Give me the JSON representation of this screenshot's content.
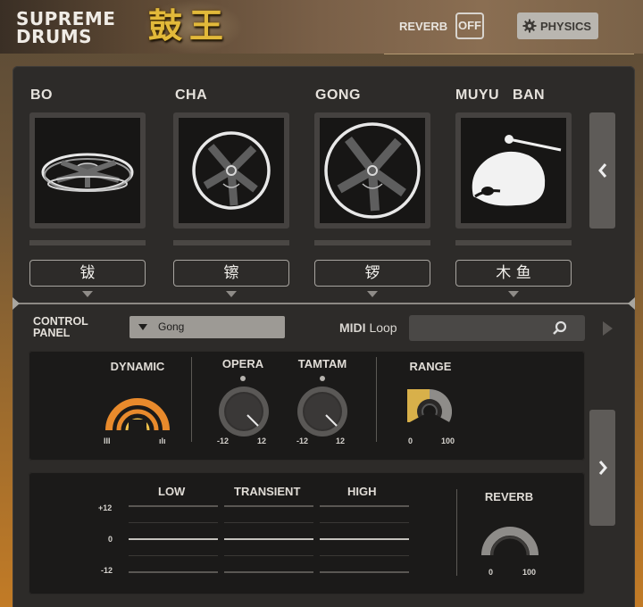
{
  "header": {
    "logo_line1": "SUPREME",
    "logo_line2": "DRUMS",
    "logo_cn": "鼓王",
    "reverb_label": "REVERB",
    "reverb_toggle": "OFF",
    "physics_label": "PHYSICS"
  },
  "instruments": [
    {
      "name": "BO",
      "cn": "钹",
      "icon": "cymbal-icon"
    },
    {
      "name": "CHA",
      "cn": "镲",
      "icon": "small-cymbal-icon"
    },
    {
      "name": "GONG",
      "cn": "锣",
      "icon": "gong-icon"
    },
    {
      "name": "MUYU   BAN",
      "cn": "木 鱼",
      "icon": "wooden-fish-icon"
    }
  ],
  "control_panel": {
    "label_line1": "CONTROL",
    "label_line2": "PANEL",
    "selected_instrument": "Gong",
    "midi_label": "MIDI",
    "loop_label": "Loop"
  },
  "knobs": {
    "dynamic": {
      "title": "DYNAMIC",
      "low_icon": "III",
      "high_icon": "ılı"
    },
    "opera": {
      "title": "OPERA",
      "min": "-12",
      "max": "12"
    },
    "tamtam": {
      "title": "TAMTAM",
      "min": "-12",
      "max": "12"
    },
    "range": {
      "title": "RANGE",
      "min": "0",
      "max": "100"
    }
  },
  "eq": {
    "bands": [
      "LOW",
      "TRANSIENT",
      "HIGH"
    ],
    "db_labels": [
      "+12",
      "0",
      "-12"
    ],
    "reverb_title": "REVERB",
    "reverb_min": "0",
    "reverb_max": "100"
  },
  "colors": {
    "accent_orange": "#e88a2c",
    "accent_yellow": "#d8b04a",
    "panel_bg": "#2d2b29"
  }
}
